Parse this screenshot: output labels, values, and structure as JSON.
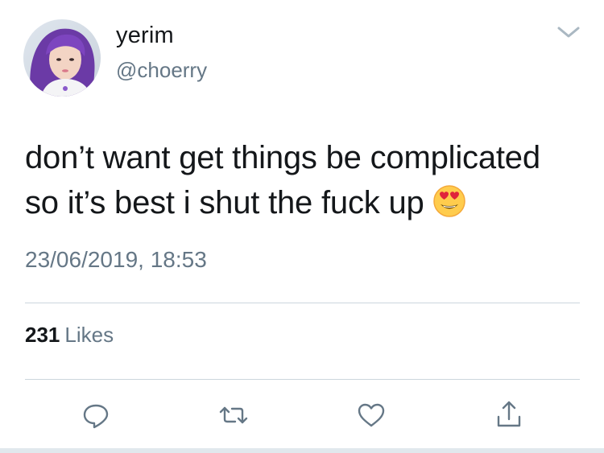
{
  "user": {
    "display_name": "yerim",
    "handle": "@choerry",
    "avatar_icon": "profile-photo"
  },
  "tweet": {
    "lines": [
      "don’t want get things be complicated",
      "so it’s best i shut the fuck up"
    ],
    "emoji": "heart-eyes-emoji",
    "timestamp": "23/06/2019, 18:53"
  },
  "stats": {
    "likes_count": "231",
    "likes_label": "Likes"
  },
  "actions": {
    "icons": [
      "reply-icon",
      "retweet-icon",
      "like-icon",
      "share-icon"
    ]
  },
  "colors": {
    "text": "#14171a",
    "secondary": "#657786",
    "divider": "#ccd6dd"
  }
}
